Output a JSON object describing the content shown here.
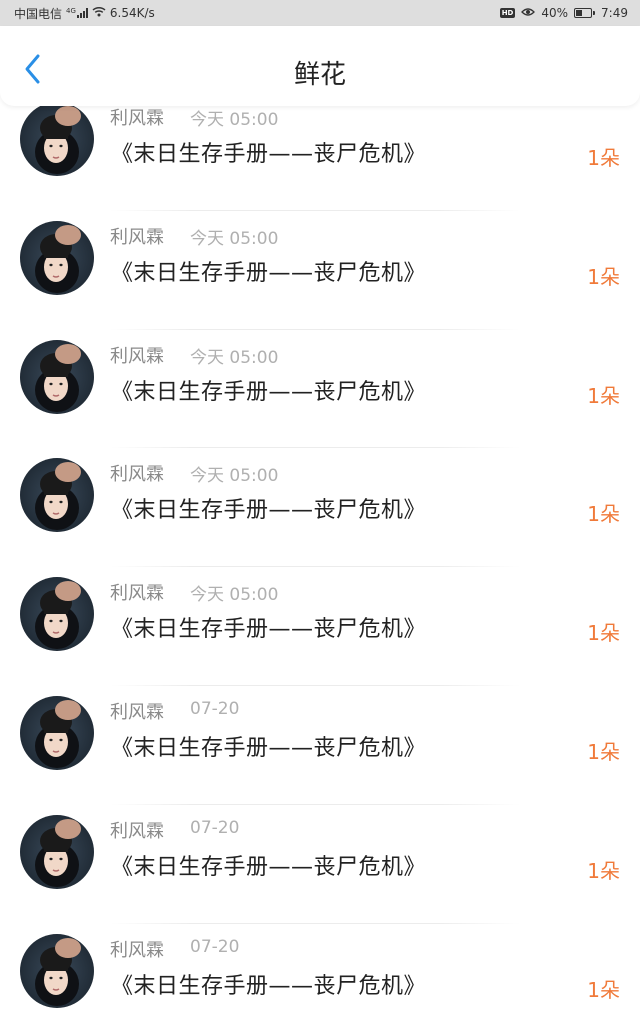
{
  "status_bar": {
    "carrier": "中国电信",
    "network": "4G",
    "speed": "6.54K/s",
    "hd": "HD",
    "battery_percent": "40%",
    "battery_level": 0.4,
    "time": "7:49"
  },
  "header": {
    "title": "鲜花",
    "back_icon": "chevron-left-icon",
    "accent_color": "#2a8fe6"
  },
  "items": [
    {
      "user": "利风霖",
      "time": "今天 05:00",
      "book": "《末日生存手册——丧尸危机》",
      "count": "1朵"
    },
    {
      "user": "利风霖",
      "time": "今天 05:00",
      "book": "《末日生存手册——丧尸危机》",
      "count": "1朵"
    },
    {
      "user": "利风霖",
      "time": "今天 05:00",
      "book": "《末日生存手册——丧尸危机》",
      "count": "1朵"
    },
    {
      "user": "利风霖",
      "time": "今天 05:00",
      "book": "《末日生存手册——丧尸危机》",
      "count": "1朵"
    },
    {
      "user": "利风霖",
      "time": "今天 05:00",
      "book": "《末日生存手册——丧尸危机》",
      "count": "1朵"
    },
    {
      "user": "利风霖",
      "time": "07-20",
      "book": "《末日生存手册——丧尸危机》",
      "count": "1朵"
    },
    {
      "user": "利风霖",
      "time": "07-20",
      "book": "《末日生存手册——丧尸危机》",
      "count": "1朵"
    },
    {
      "user": "利风霖",
      "time": "07-20",
      "book": "《末日生存手册——丧尸危机》",
      "count": "1朵"
    }
  ],
  "colors": {
    "count": "#f07a3a",
    "user": "#8a8a8a",
    "time": "#b0b0b0"
  }
}
